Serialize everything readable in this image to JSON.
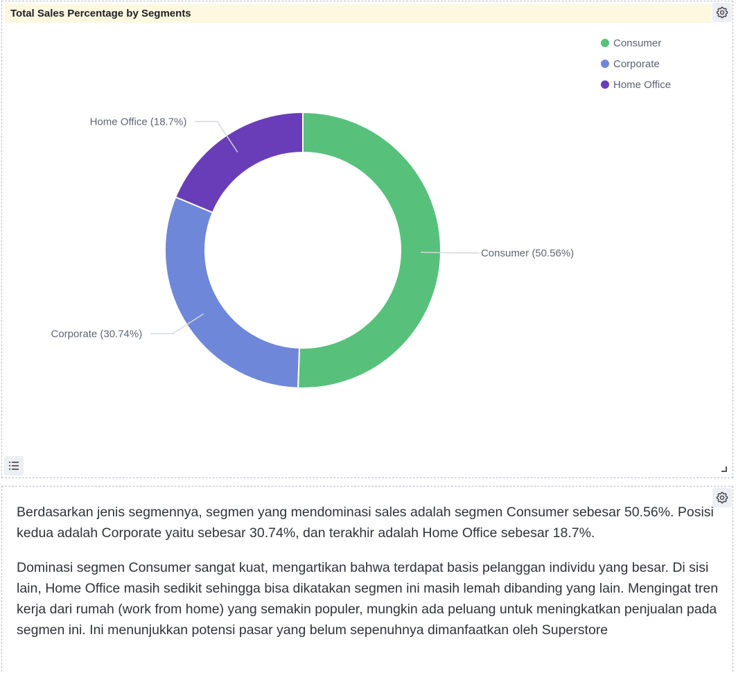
{
  "chart_panel": {
    "title": "Total Sales Percentage by Segments"
  },
  "chart_data": {
    "type": "pie",
    "style": "donut",
    "title": "Total Sales Percentage by Segments",
    "categories": [
      "Consumer",
      "Corporate",
      "Home Office"
    ],
    "values": [
      50.56,
      30.74,
      18.7
    ],
    "unit": "%",
    "colors": [
      "#57c17b",
      "#6f87d8",
      "#6a3db8"
    ],
    "slice_labels": [
      "Consumer (50.56%)",
      "Corporate (30.74%)",
      "Home Office (18.7%)"
    ],
    "legend": {
      "position": "top-right",
      "entries": [
        "Consumer",
        "Corporate",
        "Home Office"
      ]
    }
  },
  "icons": {
    "settings": "gear-icon",
    "list": "list-icon",
    "resize": "resize-handle-icon"
  },
  "text_panel": {
    "paragraphs": [
      "Berdasarkan jenis segmennya, segmen yang mendominasi sales adalah segmen Consumer sebesar 50.56%. Posisi kedua adalah Corporate yaitu sebesar 30.74%, dan terakhir adalah Home Office sebesar 18.7%.",
      "Dominasi segmen Consumer sangat kuat, mengartikan bahwa terdapat basis pelanggan individu yang besar. Di sisi lain, Home Office masih sedikit sehingga bisa dikatakan segmen ini masih lemah dibanding yang lain. Mengingat tren kerja dari rumah (work from home) yang semakin populer, mungkin ada peluang untuk meningkatkan penjualan pada segmen ini. Ini menunjukkan potensi pasar yang belum sepenuhnya dimanfaatkan oleh Superstore"
    ]
  }
}
